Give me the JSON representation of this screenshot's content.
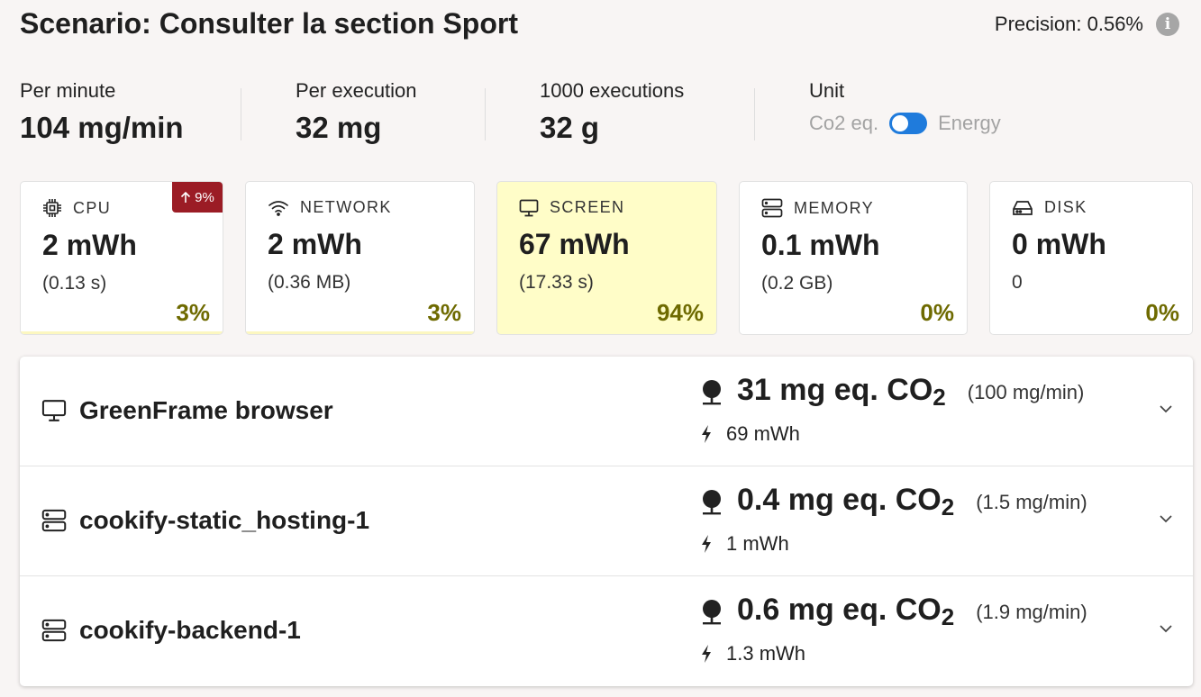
{
  "header": {
    "title": "Scenario: Consulter la section Sport",
    "precision": "Precision: 0.56%",
    "info_icon": "info-icon"
  },
  "stats": [
    {
      "label": "Per minute",
      "value": "104 mg/min"
    },
    {
      "label": "Per execution",
      "value": "32 mg"
    },
    {
      "label": "1000 executions",
      "value": "32 g"
    }
  ],
  "unit": {
    "label": "Unit",
    "left": "Co2 eq.",
    "right": "Energy",
    "toggle_on": true
  },
  "cards": [
    {
      "icon": "cpu-icon",
      "name": "CPU",
      "value": "2 mWh",
      "sub": "(0.13 s)",
      "pct": "3%",
      "badge": "9%"
    },
    {
      "icon": "wifi-icon",
      "name": "NETWORK",
      "value": "2 mWh",
      "sub": "(0.36 MB)",
      "pct": "3%"
    },
    {
      "icon": "monitor-icon",
      "name": "SCREEN",
      "value": "67 mWh",
      "sub": "(17.33 s)",
      "pct": "94%"
    },
    {
      "icon": "memory-icon",
      "name": "MEMORY",
      "value": "0.1 mWh",
      "sub": "(0.2 GB)",
      "pct": "0%"
    },
    {
      "icon": "disk-icon",
      "name": "DISK",
      "value": "0 mWh",
      "sub": "0",
      "pct": "0%"
    }
  ],
  "containers": [
    {
      "icon": "monitor-icon",
      "name": "GreenFrame browser",
      "co2": "31 mg eq. CO",
      "co2_sub": "2",
      "rate": "(100 mg/min)",
      "energy": "69 mWh"
    },
    {
      "icon": "server-icon",
      "name": "cookify-static_hosting-1",
      "co2": "0.4 mg eq. CO",
      "co2_sub": "2",
      "rate": "(1.5 mg/min)",
      "energy": "1 mWh"
    },
    {
      "icon": "server-icon",
      "name": "cookify-backend-1",
      "co2": "0.6 mg eq. CO",
      "co2_sub": "2",
      "rate": "(1.9 mg/min)",
      "energy": "1.3 mWh"
    }
  ],
  "colors": {
    "badge_red": "#9b1c25",
    "pct_olive": "#6e6a00",
    "highlight": "#fffdc8",
    "toggle_blue": "#1f7bdc"
  }
}
